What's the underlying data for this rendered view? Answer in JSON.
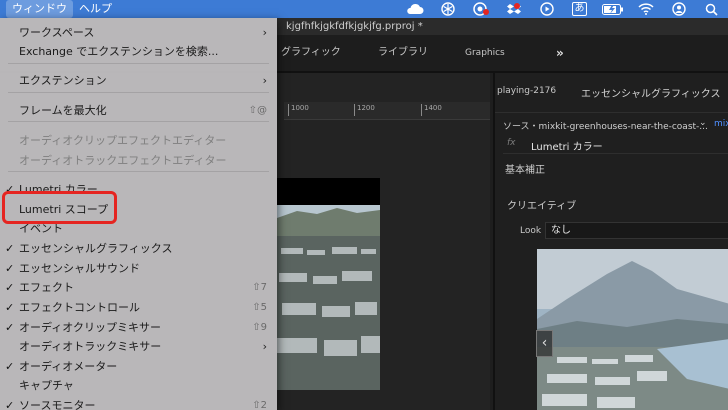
{
  "menubar": {
    "menus": [
      "ウィンドウ",
      "ヘルプ"
    ],
    "active_menu": "ウィンドウ",
    "status_icons": [
      "cloud-icon",
      "snowflake-icon",
      "record-icon",
      "dropbox-icon",
      "play-icon",
      "kana-input-icon",
      "battery-icon",
      "wifi-icon",
      "user-icon",
      "spotlight-icon"
    ],
    "kana_label": "あ",
    "accent_color": "#3d7bd5",
    "highlight_color": "#e52521"
  },
  "titlebar": {
    "project_title": "kjgfhfkjgkfdfkjgkjfg.prproj *"
  },
  "workspace_tabs": [
    "グラフィック",
    "ライブラリ",
    "Graphics"
  ],
  "workspace_more": "»",
  "ruler": {
    "ticks": [
      "1000",
      "1200",
      "1400"
    ]
  },
  "lumetri": {
    "playing_label": "playing-2176",
    "panel_title": "エッセンシャルグラフィックス",
    "source": "ソース・mixkit-greenhouses-near-the-coast-...",
    "mix_label": "mix",
    "fx_symbol": "fx",
    "effect_name": "Lumetri カラー",
    "basic_section": "基本補正",
    "creative_section": "クリエイティブ",
    "look_label": "Look",
    "look_value": "なし",
    "prev_arrow": "‹"
  },
  "menu": {
    "items": [
      {
        "label": "ワークスペース",
        "checked": false,
        "shortcut": "",
        "submenu": true,
        "disabled": false
      },
      {
        "label": "Exchange でエクステンションを検索...",
        "checked": false,
        "shortcut": "",
        "submenu": false,
        "disabled": false
      },
      {
        "label": "エクステンション",
        "checked": false,
        "shortcut": "",
        "submenu": true,
        "disabled": false
      },
      {
        "label": "フレームを最大化",
        "checked": false,
        "shortcut": "⇧@",
        "submenu": false,
        "disabled": false
      },
      {
        "label": "オーディオクリップエフェクトエディター",
        "checked": false,
        "shortcut": "",
        "submenu": false,
        "disabled": true
      },
      {
        "label": "オーディオトラックエフェクトエディター",
        "checked": false,
        "shortcut": "",
        "submenu": false,
        "disabled": true
      },
      {
        "label": "Lumetri カラー",
        "checked": true,
        "shortcut": "",
        "submenu": false,
        "disabled": false
      },
      {
        "label": "Lumetri スコープ",
        "checked": false,
        "shortcut": "",
        "submenu": false,
        "disabled": false
      },
      {
        "label": "イベント",
        "checked": false,
        "shortcut": "",
        "submenu": false,
        "disabled": false
      },
      {
        "label": "エッセンシャルグラフィックス",
        "checked": true,
        "shortcut": "",
        "submenu": false,
        "disabled": false
      },
      {
        "label": "エッセンシャルサウンド",
        "checked": true,
        "shortcut": "",
        "submenu": false,
        "disabled": false
      },
      {
        "label": "エフェクト",
        "checked": true,
        "shortcut": "⇧7",
        "submenu": false,
        "disabled": false
      },
      {
        "label": "エフェクトコントロール",
        "checked": true,
        "shortcut": "⇧5",
        "submenu": false,
        "disabled": false
      },
      {
        "label": "オーディオクリップミキサー",
        "checked": true,
        "shortcut": "⇧9",
        "submenu": false,
        "disabled": false
      },
      {
        "label": "オーディオトラックミキサー",
        "checked": false,
        "shortcut": "",
        "submenu": true,
        "disabled": false
      },
      {
        "label": "オーディオメーター",
        "checked": true,
        "shortcut": "",
        "submenu": false,
        "disabled": false
      },
      {
        "label": "キャプチャ",
        "checked": false,
        "shortcut": "",
        "submenu": false,
        "disabled": false
      },
      {
        "label": "ソースモニター",
        "checked": true,
        "shortcut": "⇧2",
        "submenu": false,
        "disabled": false
      }
    ],
    "check_glyph": "✓",
    "submenu_glyph": "›"
  }
}
